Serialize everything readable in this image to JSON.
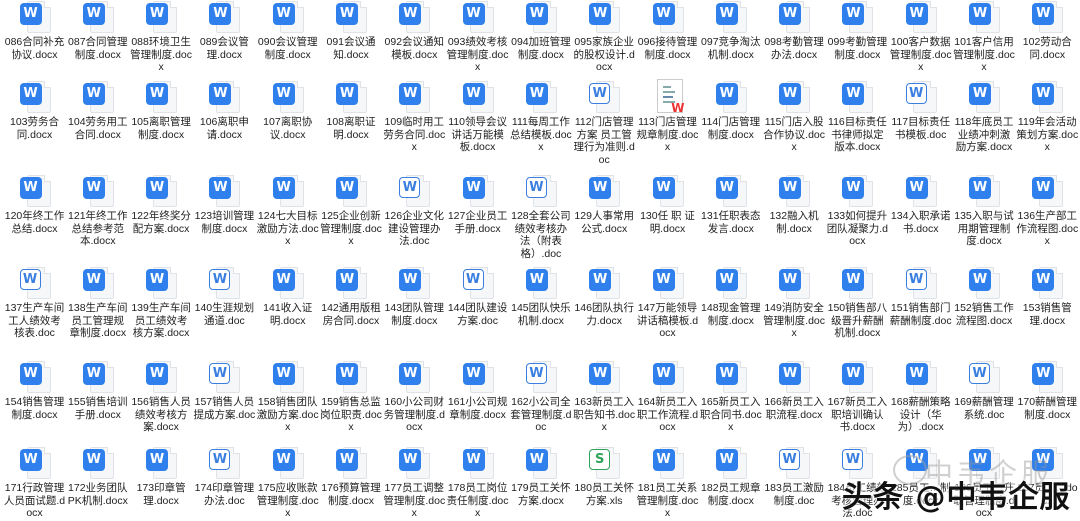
{
  "files": {
    "rows": [
      [
        {
          "name": "086合同补充协议.docx",
          "type": "docx"
        },
        {
          "name": "087合同管理制度.docx",
          "type": "docx"
        },
        {
          "name": "088环境卫生管理制度.docx",
          "type": "docx"
        },
        {
          "name": "089会议管理.docx",
          "type": "docx"
        },
        {
          "name": "090会议管理制度.docx",
          "type": "docx"
        },
        {
          "name": "091会议通知.docx",
          "type": "docx"
        },
        {
          "name": "092会议通知模板.docx",
          "type": "docx"
        },
        {
          "name": "093绩效考核管理制度.docx",
          "type": "docx"
        },
        {
          "name": "094加班管理制度.docx",
          "type": "docx"
        },
        {
          "name": "095家族企业的股权设计.docx",
          "type": "docx"
        },
        {
          "name": "096接待管理制度.docx",
          "type": "docx"
        },
        {
          "name": "097竞争淘汰机制.docx",
          "type": "docx"
        },
        {
          "name": "098考勤管理办法.docx",
          "type": "docx"
        },
        {
          "name": "099考勤管理制度.docx",
          "type": "docx"
        },
        {
          "name": "100客户数据管理制度.docx",
          "type": "docx"
        },
        {
          "name": "101客户信用管理制度.docx",
          "type": "docx"
        },
        {
          "name": "102劳动合同.docx",
          "type": "docx"
        }
      ],
      [
        {
          "name": "103劳务合同.docx",
          "type": "docx"
        },
        {
          "name": "104劳务用工合同.docx",
          "type": "docx"
        },
        {
          "name": "105离职管理制度.docx",
          "type": "docx"
        },
        {
          "name": "106离职申请.docx",
          "type": "docx"
        },
        {
          "name": "107离职协议.docx",
          "type": "docx"
        },
        {
          "name": "108离职证明.docx",
          "type": "docx"
        },
        {
          "name": "109临时用工劳务合同.docx",
          "type": "docx"
        },
        {
          "name": "110领导会议讲话万能模板.docx",
          "type": "docx"
        },
        {
          "name": "111每周工作总结模板.docx",
          "type": "docx"
        },
        {
          "name": "112门店管理方案 员工管理行为准则.doc",
          "type": "doc"
        },
        {
          "name": "113门店管理规章制度.docx",
          "type": "thumb"
        },
        {
          "name": "114门店管理制度.docx",
          "type": "docx"
        },
        {
          "name": "115门店入股合作协议.docx",
          "type": "docx"
        },
        {
          "name": "116目标责任书律师拟定版本.docx",
          "type": "docx"
        },
        {
          "name": "117目标责任书模板.doc",
          "type": "doc"
        },
        {
          "name": "118年底员工业绩冲刺激励方案.docx",
          "type": "docx"
        },
        {
          "name": "119年会活动策划方案.docx",
          "type": "docx"
        }
      ],
      [
        {
          "name": "120年终工作总结.docx",
          "type": "docx"
        },
        {
          "name": "121年终工作总结参考范本.docx",
          "type": "docx"
        },
        {
          "name": "122年终奖分配方案.docx",
          "type": "docx"
        },
        {
          "name": "123培训管理制度.docx",
          "type": "docx"
        },
        {
          "name": "124七大目标激励方法.docx",
          "type": "docx"
        },
        {
          "name": "125企业创新管理制度.docx",
          "type": "docx"
        },
        {
          "name": "126企业文化建设管理办法.doc",
          "type": "doc"
        },
        {
          "name": "127企业员工手册.docx",
          "type": "docx"
        },
        {
          "name": "128全套公司绩效考核办法（附表格）.doc",
          "type": "doc"
        },
        {
          "name": "129人事常用公式.docx",
          "type": "docx"
        },
        {
          "name": "130任 职 证 明.docx",
          "type": "docx"
        },
        {
          "name": "131任职表态发言.docx",
          "type": "docx"
        },
        {
          "name": "132融入机制.docx",
          "type": "docx"
        },
        {
          "name": "133如何提升团队凝聚力.docx",
          "type": "docx"
        },
        {
          "name": "134入职承诺书.docx",
          "type": "docx"
        },
        {
          "name": "135入职与试用期管理制度.docx",
          "type": "docx"
        },
        {
          "name": "136生产部工作流程图.docx",
          "type": "docx"
        }
      ],
      [
        {
          "name": "137生产车间工人绩效考核表.doc",
          "type": "doc"
        },
        {
          "name": "138生产车间员工管理规章制度.docx",
          "type": "docx"
        },
        {
          "name": "139生产车间员工绩效考核方案.docx",
          "type": "docx"
        },
        {
          "name": "140生涯规划通道.doc",
          "type": "doc"
        },
        {
          "name": "141收入证明.docx",
          "type": "docx"
        },
        {
          "name": "142通用版租房合同.docx",
          "type": "docx"
        },
        {
          "name": "143团队管理制度.docx",
          "type": "docx"
        },
        {
          "name": "144团队建设方案.doc",
          "type": "doc"
        },
        {
          "name": "145团队快乐机制.docx",
          "type": "docx"
        },
        {
          "name": "146团队执行力.docx",
          "type": "docx"
        },
        {
          "name": "147万能领导讲话稿模板.docx",
          "type": "docx"
        },
        {
          "name": "148现金管理制度.docx",
          "type": "docx"
        },
        {
          "name": "149消防安全管理制度.docx",
          "type": "docx"
        },
        {
          "name": "150销售部八级晋升薪酬机制.docx",
          "type": "docx"
        },
        {
          "name": "151销售部门薪酬制度.doc",
          "type": "doc"
        },
        {
          "name": "152销售工作流程图.docx",
          "type": "docx"
        },
        {
          "name": "153销售管理.docx",
          "type": "docx"
        }
      ],
      [
        {
          "name": "154销售管理制度.docx",
          "type": "docx"
        },
        {
          "name": "155销售培训手册.docx",
          "type": "docx"
        },
        {
          "name": "156销售人员绩效考核方案.docx",
          "type": "docx"
        },
        {
          "name": "157销售人员提成方案.doc",
          "type": "doc"
        },
        {
          "name": "158销售团队激励方案.docx",
          "type": "docx"
        },
        {
          "name": "159销售总监岗位职责.docx",
          "type": "docx"
        },
        {
          "name": "160小公司财务管理制度.docx",
          "type": "docx"
        },
        {
          "name": "161小公司规章制度.docx",
          "type": "docx"
        },
        {
          "name": "162小公司全套管理制度.doc",
          "type": "doc"
        },
        {
          "name": "163新员工入职告知书.docx",
          "type": "docx"
        },
        {
          "name": "164新员工入职工作流程.docx",
          "type": "docx"
        },
        {
          "name": "165新员工入职合同书.docx",
          "type": "docx"
        },
        {
          "name": "166新员工入职流程.docx",
          "type": "docx"
        },
        {
          "name": "167新员工入职培训确认书.docx",
          "type": "docx"
        },
        {
          "name": "168薪酬策略设计（华为）.docx",
          "type": "docx"
        },
        {
          "name": "169薪酬管理系统.doc",
          "type": "doc"
        },
        {
          "name": "170薪酬管理制度.docx",
          "type": "docx"
        }
      ],
      [
        {
          "name": "171行政管理人员面试题.docx",
          "type": "docx"
        },
        {
          "name": "172业务团队PK机制.docx",
          "type": "docx"
        },
        {
          "name": "173印章管理.docx",
          "type": "docx"
        },
        {
          "name": "174印章管理办法.doc",
          "type": "doc"
        },
        {
          "name": "175应收账款管理制度.docx",
          "type": "docx"
        },
        {
          "name": "176预算管理制度.docx",
          "type": "docx"
        },
        {
          "name": "177员工调整管理制度.docx",
          "type": "docx"
        },
        {
          "name": "178员工岗位责任制度.docx",
          "type": "docx"
        },
        {
          "name": "179员工关怀方案.docx",
          "type": "docx"
        },
        {
          "name": "180员工关怀方案.xls",
          "type": "xls"
        },
        {
          "name": "181员工关系管理制度.docx",
          "type": "docx"
        },
        {
          "name": "182员工规章制度.docx",
          "type": "docx"
        },
        {
          "name": "183员工激励制度.doc",
          "type": "doc"
        },
        {
          "name": "184员工绩效考核管理办法.doc",
          "type": "doc"
        },
        {
          "name": "185员工…制度.docx",
          "type": "docx"
        },
        {
          "name": "186员工…升职管理制度.docx",
          "type": "docx"
        },
        {
          "name": "187员工…docx",
          "type": "docx"
        }
      ]
    ]
  },
  "icons": {
    "docx": "W",
    "doc": "W",
    "xls": "S",
    "thumb": "W"
  },
  "watermark": {
    "main": "头条 @中韦企服",
    "faint": "中韦企服"
  },
  "colors": {
    "word": "#2f80ed",
    "excel": "#2fa35a",
    "wps": "#e33333"
  }
}
